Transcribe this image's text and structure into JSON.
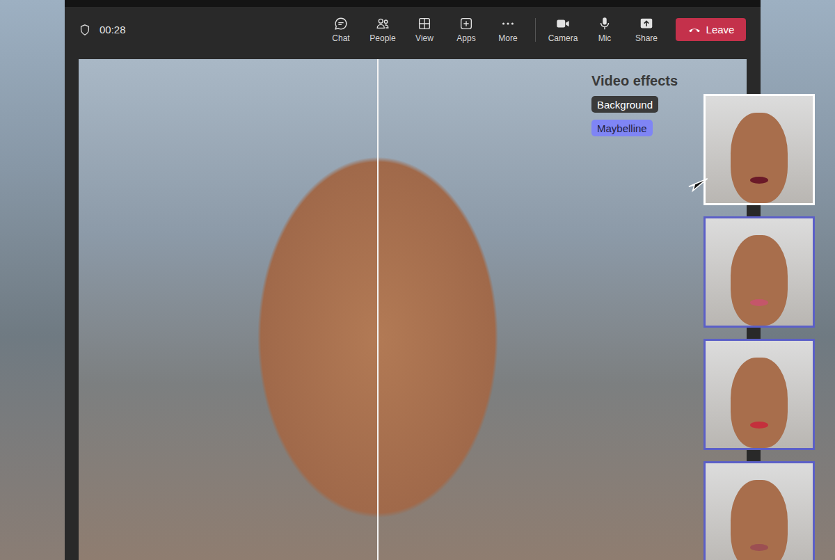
{
  "call": {
    "timer": "00:28"
  },
  "toolbar": {
    "main": [
      {
        "label": "Chat"
      },
      {
        "label": "People"
      },
      {
        "label": "View"
      },
      {
        "label": "Apps"
      },
      {
        "label": "More"
      }
    ],
    "devices": [
      {
        "label": "Camera"
      },
      {
        "label": "Mic"
      },
      {
        "label": "Share"
      }
    ]
  },
  "leave_button": {
    "label": "Leave"
  },
  "video_effects": {
    "title": "Video effects",
    "categories": [
      {
        "label": "Background",
        "selected": false
      },
      {
        "label": "Maybelline",
        "selected": true
      }
    ]
  },
  "looks": [
    {
      "selected": true,
      "color": "#6b1a28"
    },
    {
      "selected": false,
      "color": "#c4566a"
    },
    {
      "selected": false,
      "color": "#c4303c"
    },
    {
      "selected": false,
      "color": "#9c4f52"
    }
  ]
}
